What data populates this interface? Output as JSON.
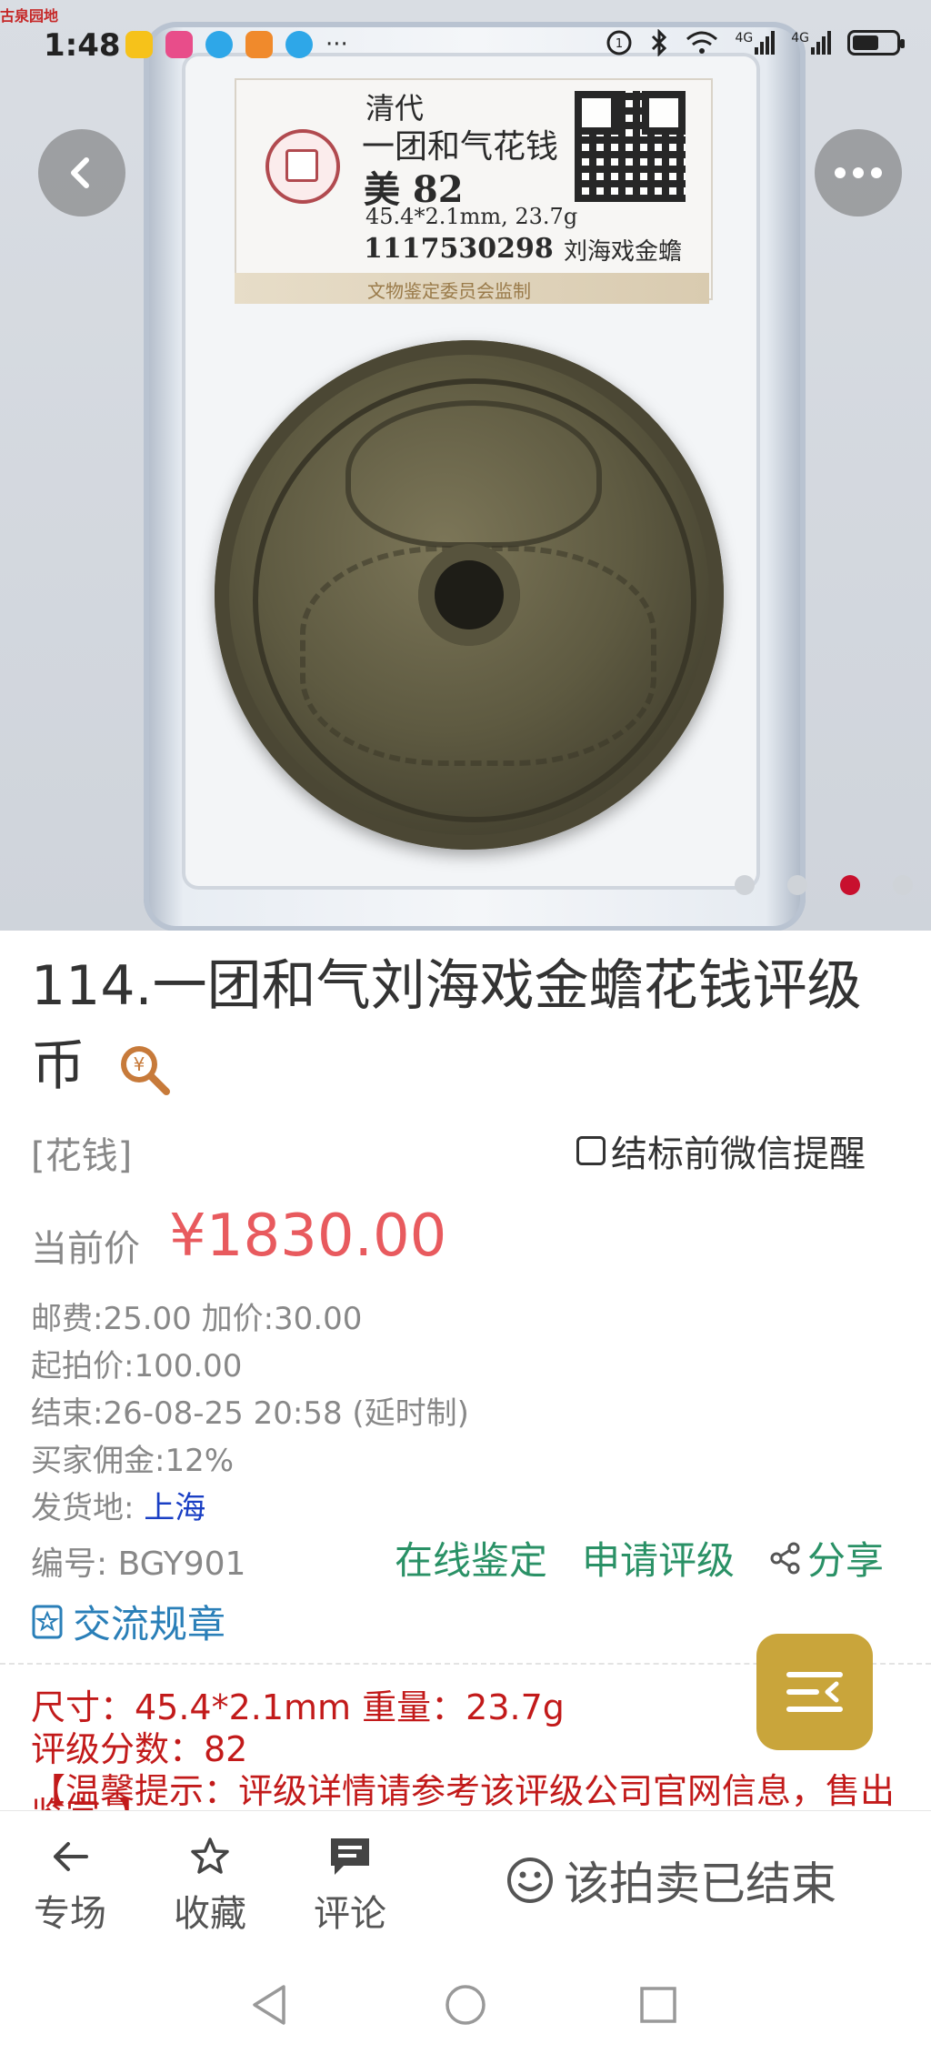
{
  "status_bar": {
    "app_tag": "古泉园地",
    "time": "1:48",
    "more": "···",
    "network_1": "4G",
    "network_2": "4G"
  },
  "gallery": {
    "label": {
      "dynasty": "清代",
      "coin_name": "一团和气花钱",
      "grade": "美 82",
      "specs": "45.4*2.1mm, 23.7g",
      "cert_number": "1117530298",
      "coin_subname": "刘海戏金蟾",
      "footer": "文物鉴定委员会监制"
    },
    "pages_total": 4,
    "current_page": 3
  },
  "item": {
    "title": "114.一团和气刘海戏金蟾花钱评级币",
    "category": "[花钱]",
    "remind_label": "结标前微信提醒",
    "price_label": "当前价",
    "price": "¥1830.00",
    "shipping_increment": "邮费:25.00  加价:30.00",
    "start_price": "起拍价:100.00",
    "end_time": "结束:26-08-25 20:58 (延时制)",
    "commission": "买家佣金:12%",
    "ship_from_label": "发货地: ",
    "ship_from": "上海",
    "item_no": "编号: BGY901",
    "online_appraisal": "在线鉴定",
    "apply_grading": "申请评级",
    "share": "分享",
    "rules": "交流规章"
  },
  "description": {
    "size_weight": "尺寸：45.4*2.1mm 重量：23.7g",
    "grade_score": "评级分数：82",
    "notice": "【温馨提示：评级详情请参考该评级公司官网信息，售出",
    "notice_cut": "鉴定。】"
  },
  "bottom_bar": {
    "tab_venue": "专场",
    "tab_favorite": "收藏",
    "tab_comment": "评论",
    "ended": "该拍卖已结束"
  },
  "colors": {
    "price": "#e85a5e",
    "action_green": "#2a9166",
    "link_blue": "#1a3fc4",
    "desc_red": "#c21a1a",
    "fab_gold": "#c9a53b"
  }
}
